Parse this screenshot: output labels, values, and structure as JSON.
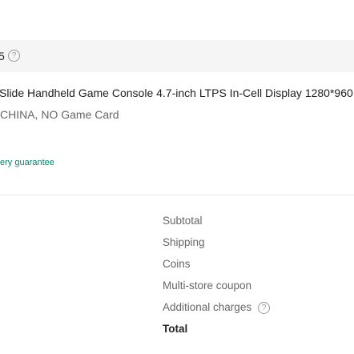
{
  "store": {
    "code_fragment": "5",
    "help_icon": "question-circle-icon"
  },
  "item": {
    "title": "Slide Handheld Game Console 4.7-inch LTPS In-Cell Display 1280*960",
    "variant": "CHINA, NO Game Card",
    "delivery_note": "ery guarantee"
  },
  "summary": {
    "subtotal_label": "Subtotal",
    "shipping_label": "Shipping",
    "coins_label": "Coins",
    "coupon_label": "Multi-store coupon",
    "additional_label": "Additional charges",
    "additional_help_icon": "question-circle-icon",
    "total_label": "Total"
  }
}
